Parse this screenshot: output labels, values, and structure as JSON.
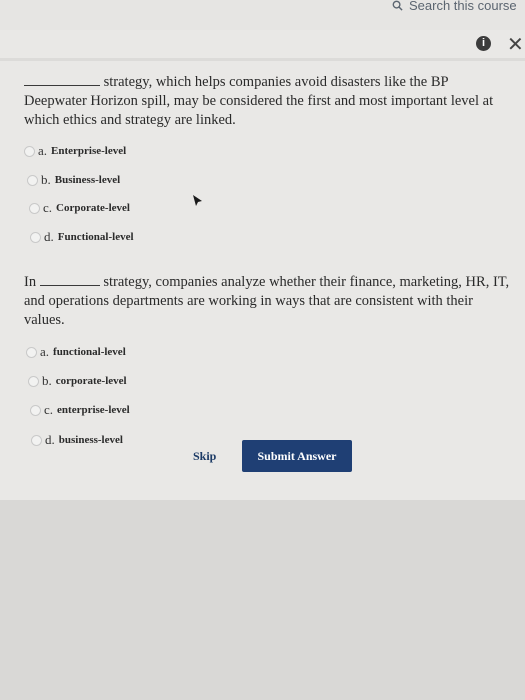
{
  "header": {
    "search_label": "Search this course"
  },
  "questions": [
    {
      "text_start": "",
      "text_after_blank": "strategy, which helps companies avoid disasters like the BP Deepwater Horizon spill, may be considered the first and most important level at which ethics and strategy are linked.",
      "options": [
        {
          "letter": "a.",
          "label": "Enterprise-level"
        },
        {
          "letter": "b.",
          "label": "Business-level"
        },
        {
          "letter": "c.",
          "label": "Corporate-level"
        },
        {
          "letter": "d.",
          "label": "Functional-level"
        }
      ]
    },
    {
      "text_start": "In",
      "text_after_blank": "strategy, companies analyze whether their finance, marketing, HR, IT, and operations departments are working in ways that are consistent with their values.",
      "options": [
        {
          "letter": "a.",
          "label": "functional-level"
        },
        {
          "letter": "b.",
          "label": "corporate-level"
        },
        {
          "letter": "c.",
          "label": "enterprise-level"
        },
        {
          "letter": "d.",
          "label": "business-level"
        }
      ]
    }
  ],
  "actions": {
    "skip_label": "Skip",
    "submit_label": "Submit Answer"
  }
}
